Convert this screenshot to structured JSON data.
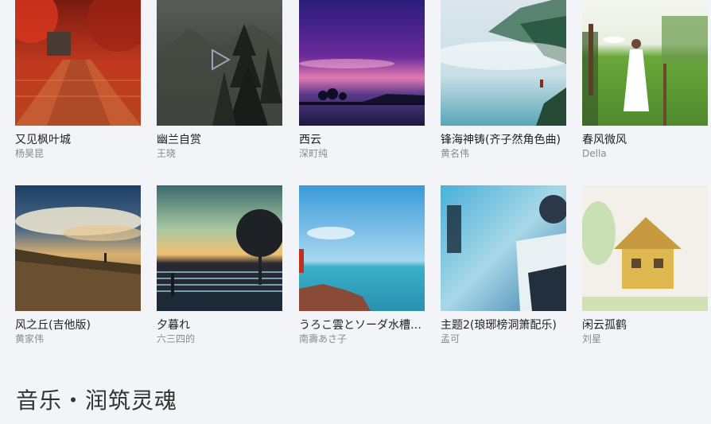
{
  "albums": [
    {
      "title": "又见枫叶城",
      "artist": "杨昊昆",
      "cover_icon": "autumn-maple-path-image"
    },
    {
      "title": "幽兰自赏",
      "artist": "王晓",
      "cover_icon": "misty-forest-image"
    },
    {
      "title": "西云",
      "artist": "深町纯",
      "cover_icon": "purple-sunset-lake-image"
    },
    {
      "title": "锋海神铸(齐子然角色曲)",
      "artist": "黄名伟",
      "cover_icon": "foggy-lake-boat-image"
    },
    {
      "title": "春风微风",
      "artist": "Della",
      "cover_icon": "girl-in-field-image"
    },
    {
      "title": "风之丘(吉他版)",
      "artist": "黄家伟",
      "cover_icon": "hill-sky-clouds-image"
    },
    {
      "title": "夕暮れ",
      "artist": "六三四的",
      "cover_icon": "anime-sunset-rice-field-image"
    },
    {
      "title": "うろこ雲とソーダ水槽（少年期）",
      "artist": "南壽あさ子",
      "cover_icon": "blue-sea-rocks-image"
    },
    {
      "title": "主题2(琅琊榜洞箫配乐)",
      "artist": "孟可",
      "cover_icon": "langya-bang-character-image"
    },
    {
      "title": "闲云孤鹤",
      "artist": "刘星",
      "cover_icon": "watercolor-house-image"
    }
  ],
  "hover_play_index": 1,
  "section_title": "音乐・润筑灵魂"
}
